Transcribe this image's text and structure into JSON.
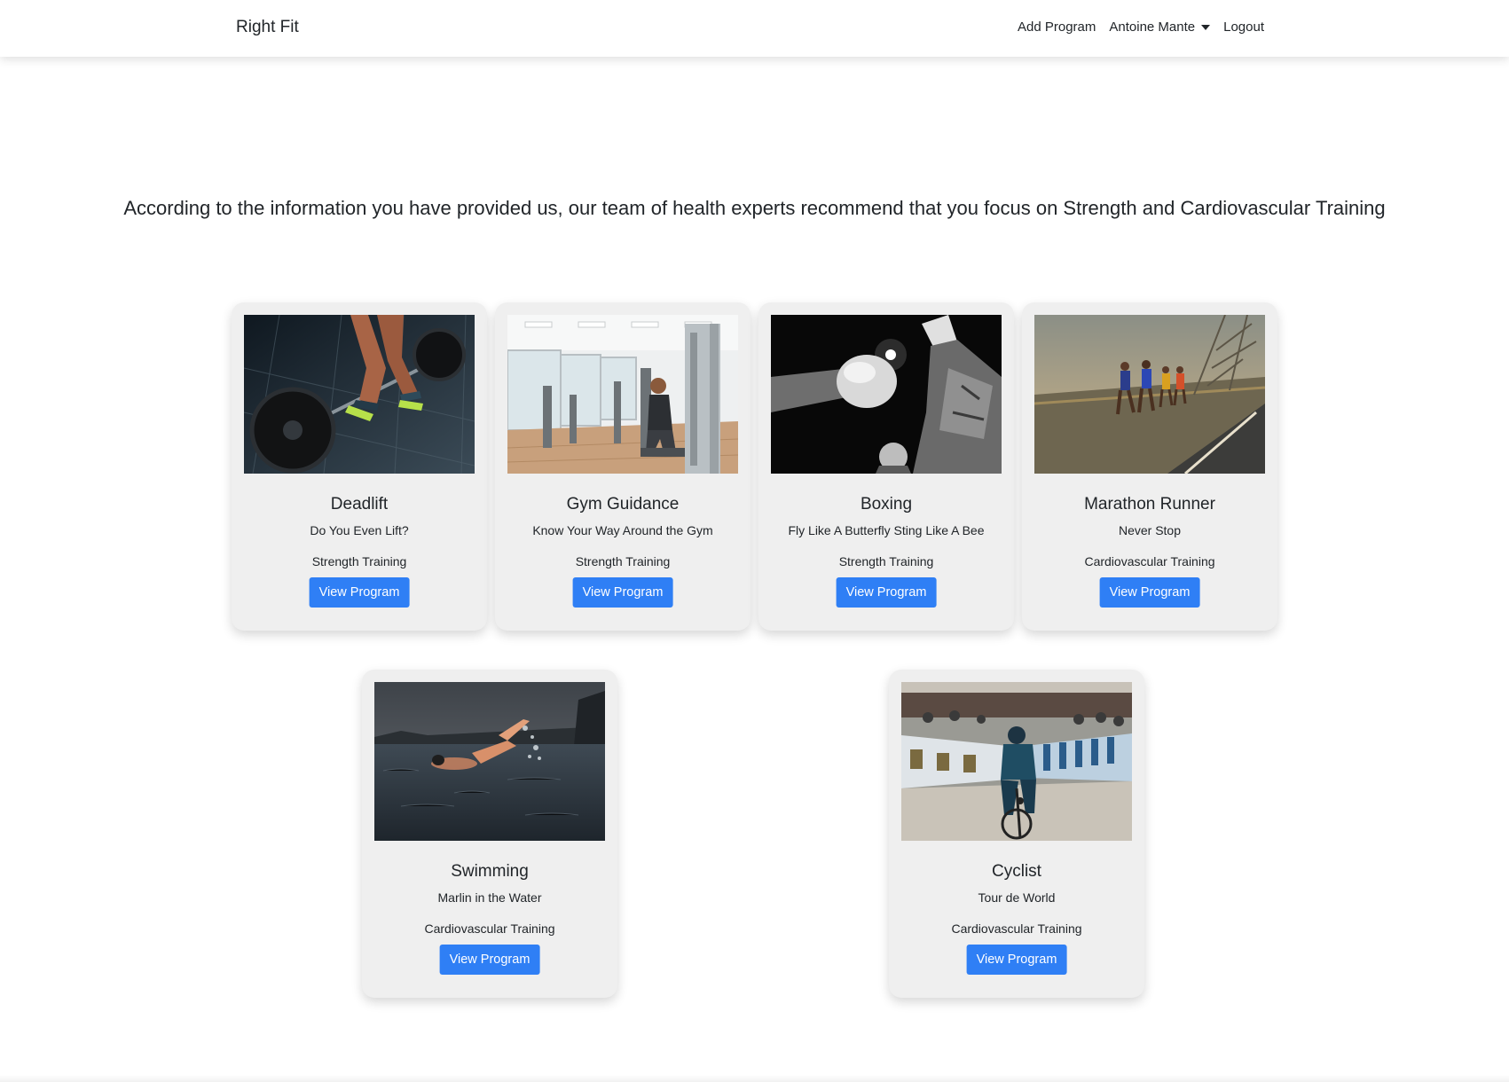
{
  "nav": {
    "brand": "Right Fit",
    "add_program": "Add Program",
    "user_name": "Antoine Mante",
    "logout": "Logout"
  },
  "headline": "According to the information you have provided us, our team of health experts recommend that you focus on Strength and Cardiovascular Training",
  "programs": [
    {
      "title": "Deadlift",
      "subtitle": "Do You Even Lift?",
      "category": "Strength Training",
      "button": "View Program"
    },
    {
      "title": "Gym Guidance",
      "subtitle": "Know Your Way Around the Gym",
      "category": "Strength Training",
      "button": "View Program"
    },
    {
      "title": "Boxing",
      "subtitle": "Fly Like A Butterfly Sting Like A Bee",
      "category": "Strength Training",
      "button": "View Program"
    },
    {
      "title": "Marathon Runner",
      "subtitle": "Never Stop",
      "category": "Cardiovascular Training",
      "button": "View Program"
    },
    {
      "title": "Swimming",
      "subtitle": "Marlin in the Water",
      "category": "Cardiovascular Training",
      "button": "View Program"
    },
    {
      "title": "Cyclist",
      "subtitle": "Tour de World",
      "category": "Cardiovascular Training",
      "button": "View Program"
    }
  ],
  "colors": {
    "primary_button": "#2f7ff5",
    "card_background": "#efefef"
  }
}
